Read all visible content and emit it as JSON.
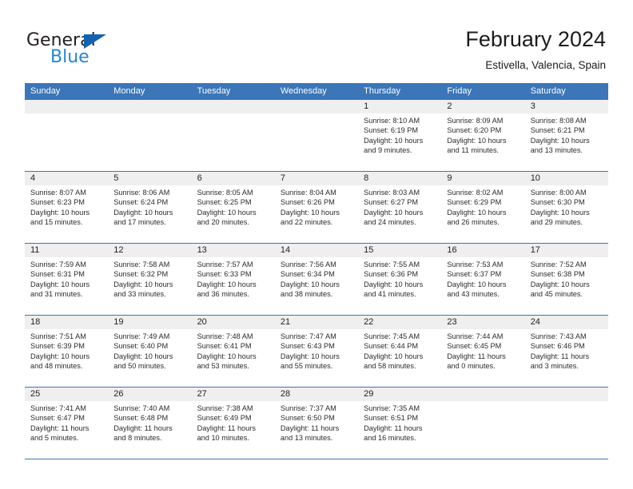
{
  "brand": {
    "name_part1": "General",
    "name_part2": "Blue",
    "triangle_color": "#1263b0",
    "blue_color": "#2585d3"
  },
  "header": {
    "title": "February 2024",
    "subtitle": "Estivella, Valencia, Spain"
  },
  "theme": {
    "header_blue": "#3a76b8",
    "day_band_gray": "#efefef",
    "cell_white": "#ffffff",
    "text_color": "#2b2b2b"
  },
  "weekdays": [
    "Sunday",
    "Monday",
    "Tuesday",
    "Wednesday",
    "Thursday",
    "Friday",
    "Saturday"
  ],
  "weeks": [
    [
      {
        "day": "",
        "empty": true,
        "sunrise": "",
        "sunset": "",
        "daylight_1": "",
        "daylight_2": ""
      },
      {
        "day": "",
        "empty": true,
        "sunrise": "",
        "sunset": "",
        "daylight_1": "",
        "daylight_2": ""
      },
      {
        "day": "",
        "empty": true,
        "sunrise": "",
        "sunset": "",
        "daylight_1": "",
        "daylight_2": ""
      },
      {
        "day": "",
        "empty": true,
        "sunrise": "",
        "sunset": "",
        "daylight_1": "",
        "daylight_2": ""
      },
      {
        "day": "1",
        "empty": false,
        "sunrise": "Sunrise: 8:10 AM",
        "sunset": "Sunset: 6:19 PM",
        "daylight_1": "Daylight: 10 hours",
        "daylight_2": "and 9 minutes."
      },
      {
        "day": "2",
        "empty": false,
        "sunrise": "Sunrise: 8:09 AM",
        "sunset": "Sunset: 6:20 PM",
        "daylight_1": "Daylight: 10 hours",
        "daylight_2": "and 11 minutes."
      },
      {
        "day": "3",
        "empty": false,
        "sunrise": "Sunrise: 8:08 AM",
        "sunset": "Sunset: 6:21 PM",
        "daylight_1": "Daylight: 10 hours",
        "daylight_2": "and 13 minutes."
      }
    ],
    [
      {
        "day": "4",
        "empty": false,
        "sunrise": "Sunrise: 8:07 AM",
        "sunset": "Sunset: 6:23 PM",
        "daylight_1": "Daylight: 10 hours",
        "daylight_2": "and 15 minutes."
      },
      {
        "day": "5",
        "empty": false,
        "sunrise": "Sunrise: 8:06 AM",
        "sunset": "Sunset: 6:24 PM",
        "daylight_1": "Daylight: 10 hours",
        "daylight_2": "and 17 minutes."
      },
      {
        "day": "6",
        "empty": false,
        "sunrise": "Sunrise: 8:05 AM",
        "sunset": "Sunset: 6:25 PM",
        "daylight_1": "Daylight: 10 hours",
        "daylight_2": "and 20 minutes."
      },
      {
        "day": "7",
        "empty": false,
        "sunrise": "Sunrise: 8:04 AM",
        "sunset": "Sunset: 6:26 PM",
        "daylight_1": "Daylight: 10 hours",
        "daylight_2": "and 22 minutes."
      },
      {
        "day": "8",
        "empty": false,
        "sunrise": "Sunrise: 8:03 AM",
        "sunset": "Sunset: 6:27 PM",
        "daylight_1": "Daylight: 10 hours",
        "daylight_2": "and 24 minutes."
      },
      {
        "day": "9",
        "empty": false,
        "sunrise": "Sunrise: 8:02 AM",
        "sunset": "Sunset: 6:29 PM",
        "daylight_1": "Daylight: 10 hours",
        "daylight_2": "and 26 minutes."
      },
      {
        "day": "10",
        "empty": false,
        "sunrise": "Sunrise: 8:00 AM",
        "sunset": "Sunset: 6:30 PM",
        "daylight_1": "Daylight: 10 hours",
        "daylight_2": "and 29 minutes."
      }
    ],
    [
      {
        "day": "11",
        "empty": false,
        "sunrise": "Sunrise: 7:59 AM",
        "sunset": "Sunset: 6:31 PM",
        "daylight_1": "Daylight: 10 hours",
        "daylight_2": "and 31 minutes."
      },
      {
        "day": "12",
        "empty": false,
        "sunrise": "Sunrise: 7:58 AM",
        "sunset": "Sunset: 6:32 PM",
        "daylight_1": "Daylight: 10 hours",
        "daylight_2": "and 33 minutes."
      },
      {
        "day": "13",
        "empty": false,
        "sunrise": "Sunrise: 7:57 AM",
        "sunset": "Sunset: 6:33 PM",
        "daylight_1": "Daylight: 10 hours",
        "daylight_2": "and 36 minutes."
      },
      {
        "day": "14",
        "empty": false,
        "sunrise": "Sunrise: 7:56 AM",
        "sunset": "Sunset: 6:34 PM",
        "daylight_1": "Daylight: 10 hours",
        "daylight_2": "and 38 minutes."
      },
      {
        "day": "15",
        "empty": false,
        "sunrise": "Sunrise: 7:55 AM",
        "sunset": "Sunset: 6:36 PM",
        "daylight_1": "Daylight: 10 hours",
        "daylight_2": "and 41 minutes."
      },
      {
        "day": "16",
        "empty": false,
        "sunrise": "Sunrise: 7:53 AM",
        "sunset": "Sunset: 6:37 PM",
        "daylight_1": "Daylight: 10 hours",
        "daylight_2": "and 43 minutes."
      },
      {
        "day": "17",
        "empty": false,
        "sunrise": "Sunrise: 7:52 AM",
        "sunset": "Sunset: 6:38 PM",
        "daylight_1": "Daylight: 10 hours",
        "daylight_2": "and 45 minutes."
      }
    ],
    [
      {
        "day": "18",
        "empty": false,
        "sunrise": "Sunrise: 7:51 AM",
        "sunset": "Sunset: 6:39 PM",
        "daylight_1": "Daylight: 10 hours",
        "daylight_2": "and 48 minutes."
      },
      {
        "day": "19",
        "empty": false,
        "sunrise": "Sunrise: 7:49 AM",
        "sunset": "Sunset: 6:40 PM",
        "daylight_1": "Daylight: 10 hours",
        "daylight_2": "and 50 minutes."
      },
      {
        "day": "20",
        "empty": false,
        "sunrise": "Sunrise: 7:48 AM",
        "sunset": "Sunset: 6:41 PM",
        "daylight_1": "Daylight: 10 hours",
        "daylight_2": "and 53 minutes."
      },
      {
        "day": "21",
        "empty": false,
        "sunrise": "Sunrise: 7:47 AM",
        "sunset": "Sunset: 6:43 PM",
        "daylight_1": "Daylight: 10 hours",
        "daylight_2": "and 55 minutes."
      },
      {
        "day": "22",
        "empty": false,
        "sunrise": "Sunrise: 7:45 AM",
        "sunset": "Sunset: 6:44 PM",
        "daylight_1": "Daylight: 10 hours",
        "daylight_2": "and 58 minutes."
      },
      {
        "day": "23",
        "empty": false,
        "sunrise": "Sunrise: 7:44 AM",
        "sunset": "Sunset: 6:45 PM",
        "daylight_1": "Daylight: 11 hours",
        "daylight_2": "and 0 minutes."
      },
      {
        "day": "24",
        "empty": false,
        "sunrise": "Sunrise: 7:43 AM",
        "sunset": "Sunset: 6:46 PM",
        "daylight_1": "Daylight: 11 hours",
        "daylight_2": "and 3 minutes."
      }
    ],
    [
      {
        "day": "25",
        "empty": false,
        "sunrise": "Sunrise: 7:41 AM",
        "sunset": "Sunset: 6:47 PM",
        "daylight_1": "Daylight: 11 hours",
        "daylight_2": "and 5 minutes."
      },
      {
        "day": "26",
        "empty": false,
        "sunrise": "Sunrise: 7:40 AM",
        "sunset": "Sunset: 6:48 PM",
        "daylight_1": "Daylight: 11 hours",
        "daylight_2": "and 8 minutes."
      },
      {
        "day": "27",
        "empty": false,
        "sunrise": "Sunrise: 7:38 AM",
        "sunset": "Sunset: 6:49 PM",
        "daylight_1": "Daylight: 11 hours",
        "daylight_2": "and 10 minutes."
      },
      {
        "day": "28",
        "empty": false,
        "sunrise": "Sunrise: 7:37 AM",
        "sunset": "Sunset: 6:50 PM",
        "daylight_1": "Daylight: 11 hours",
        "daylight_2": "and 13 minutes."
      },
      {
        "day": "29",
        "empty": false,
        "sunrise": "Sunrise: 7:35 AM",
        "sunset": "Sunset: 6:51 PM",
        "daylight_1": "Daylight: 11 hours",
        "daylight_2": "and 16 minutes."
      },
      {
        "day": "",
        "empty": true,
        "sunrise": "",
        "sunset": "",
        "daylight_1": "",
        "daylight_2": ""
      },
      {
        "day": "",
        "empty": true,
        "sunrise": "",
        "sunset": "",
        "daylight_1": "",
        "daylight_2": ""
      }
    ]
  ]
}
